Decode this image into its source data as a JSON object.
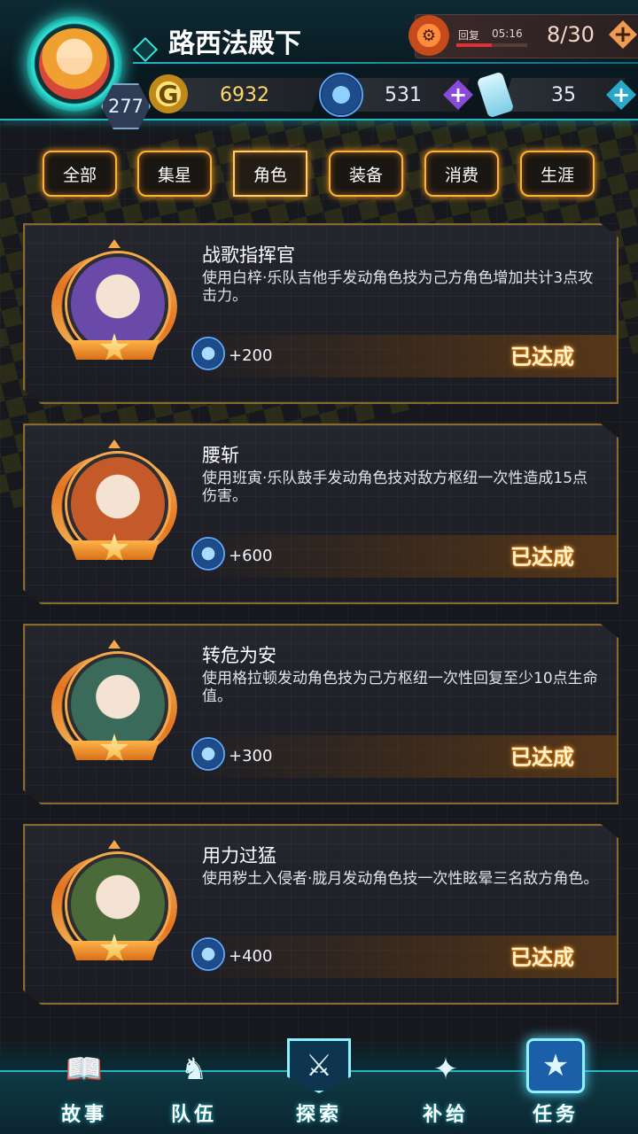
{
  "player": {
    "name": "路西法殿下",
    "level": "277"
  },
  "stamina": {
    "recover_label": "回复",
    "recover_time": "05:16",
    "count": "8/30",
    "recover_progress": 0.5
  },
  "resources": {
    "gold": "6932",
    "gems": "531",
    "tickets": "35"
  },
  "tabs": [
    {
      "label": "全部",
      "active": false
    },
    {
      "label": "集星",
      "active": false
    },
    {
      "label": "角色",
      "active": true
    },
    {
      "label": "装备",
      "active": false
    },
    {
      "label": "消费",
      "active": false
    },
    {
      "label": "生涯",
      "active": false
    }
  ],
  "achievements": [
    {
      "title": "战歌指挥官",
      "desc": "使用白梓·乐队吉他手发动角色技为己方角色增加共计3点攻击力。",
      "reward": "+200",
      "status": "已达成",
      "portrait_color": "#6a4aa8"
    },
    {
      "title": "腰斩",
      "desc": "使用班寅·乐队鼓手发动角色技对敌方枢纽一次性造成15点伤害。",
      "reward": "+600",
      "status": "已达成",
      "portrait_color": "#c45a2a"
    },
    {
      "title": "转危为安",
      "desc": "使用格拉顿发动角色技为己方枢纽一次性回复至少10点生命值。",
      "reward": "+300",
      "status": "已达成",
      "portrait_color": "#3a6a5a"
    },
    {
      "title": "用力过猛",
      "desc": "使用秽土入侵者·胧月发动角色技一次性眩晕三名敌方角色。",
      "reward": "+400",
      "status": "已达成",
      "portrait_color": "#4a6a3a"
    }
  ],
  "nav": [
    {
      "label": "故事",
      "icon": "book-icon"
    },
    {
      "label": "队伍",
      "icon": "knight-chess-icon"
    },
    {
      "label": "探索",
      "icon": "crossed-swords-shield-icon"
    },
    {
      "label": "补给",
      "icon": "supply-robot-icon"
    },
    {
      "label": "任务",
      "icon": "star-badge-icon"
    }
  ],
  "colors": {
    "accent_cyan": "#1fb7c4",
    "tab_orange": "#ffb23a",
    "gold": "#ffd86a"
  }
}
